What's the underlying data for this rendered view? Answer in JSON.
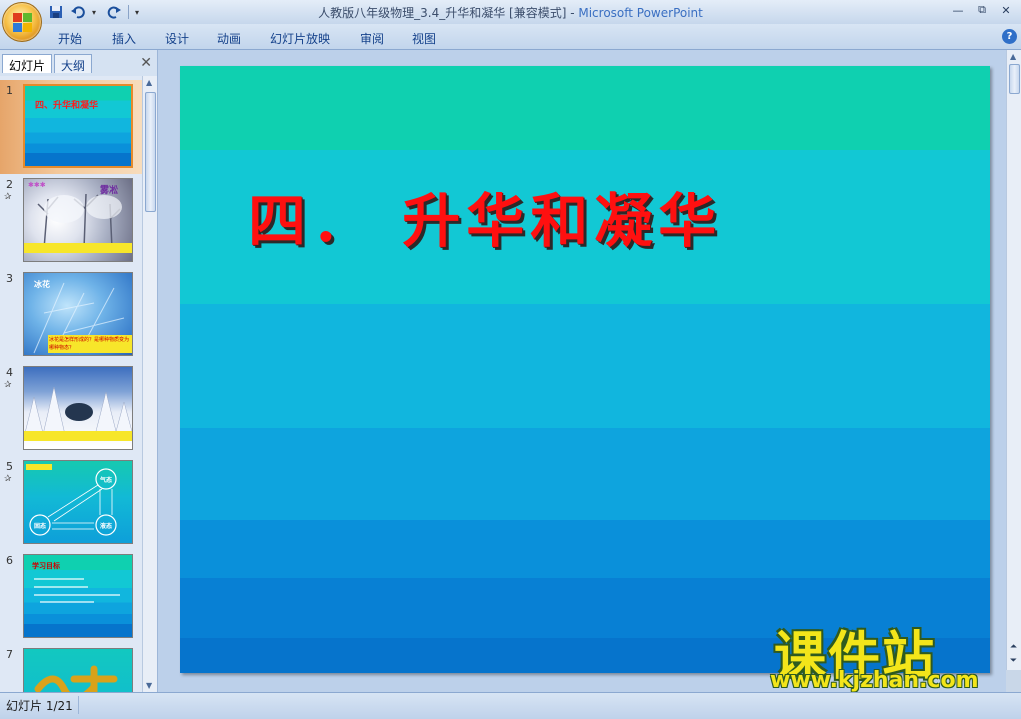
{
  "window": {
    "title_prefix": "人教版八年级物理_3.4_升华和凝华 [兼容模式] - ",
    "title_app": "Microsoft PowerPoint"
  },
  "qat": {
    "save_icon": "save-icon",
    "undo_icon": "undo-icon",
    "redo_icon": "redo-icon"
  },
  "ribbon": {
    "tabs": [
      "开始",
      "插入",
      "设计",
      "动画",
      "幻灯片放映",
      "审阅",
      "视图"
    ]
  },
  "left_pane": {
    "tabs": [
      "幻灯片",
      "大纲"
    ],
    "close": "✕",
    "thumbnails": [
      {
        "num": "1",
        "title": "四、升华和凝华"
      },
      {
        "num": "2",
        "title": "雾凇"
      },
      {
        "num": "3",
        "title": "冰花",
        "caption": "冰花是怎样形成的？是哪种物质变为哪种物态？"
      },
      {
        "num": "4"
      },
      {
        "num": "5",
        "labels": [
          "固态",
          "气态",
          "液态"
        ]
      },
      {
        "num": "6",
        "title": "学习目标"
      },
      {
        "num": "7"
      }
    ]
  },
  "slide": {
    "title": "四． 升华和凝华",
    "band_colors": [
      "#0fd0b0",
      "#12c8d4",
      "#11b6de",
      "#0ea4de",
      "#0a90da",
      "#0880d4",
      "#0674cc"
    ]
  },
  "watermark": {
    "brand": "课件站",
    "url": "www.kjzhan.com"
  },
  "status": {
    "slide_counter": "幻灯片 1/21"
  }
}
